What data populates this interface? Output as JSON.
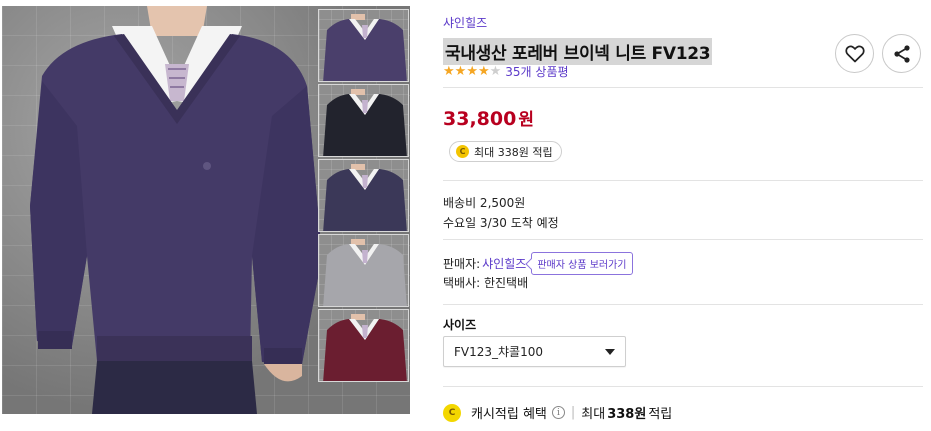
{
  "product": {
    "brand": "샤인힐즈",
    "title": "국내생산 포레버 브이넥 니트 FV123",
    "rating": 4,
    "rating_max": 5,
    "review_count_text": "35개 상품평",
    "price_value": "33,800",
    "price_unit": "원",
    "point_coin": "C",
    "point_text": "최대 338원 적립"
  },
  "delivery": {
    "fee_text": "배송비 2,500원",
    "arrival_text": "수요일 3/30 도착 예정"
  },
  "seller": {
    "label": "판매자:",
    "name": "샤인힐즈",
    "link_label": "판매자 상품 보러가기",
    "courier_text": "택배사: 한진택배"
  },
  "options": {
    "size_label": "사이즈",
    "size_selected": "FV123_챠콜100"
  },
  "cash": {
    "coin": "C",
    "label": "캐시적립 혜택",
    "info_glyph": "i",
    "separator": "|",
    "max_prefix": "최대",
    "max_amount": "338원",
    "max_suffix": "적립"
  },
  "icons": {
    "heart": "heart-icon",
    "share": "share-icon",
    "star": "star-icon",
    "dropdown": "chevron-down-icon"
  },
  "thumbnails": [
    {
      "color_name": "purple",
      "color": "#4a3f6b"
    },
    {
      "color_name": "black",
      "color": "#22232d"
    },
    {
      "color_name": "navy",
      "color": "#3b3858"
    },
    {
      "color_name": "gray",
      "color": "#a6a6ab"
    },
    {
      "color_name": "burgundy",
      "color": "#6b1e30"
    }
  ],
  "colors": {
    "accent": "#5b39c9",
    "price": "#b8001f",
    "star": "#f5a623",
    "coin": "#f3c400"
  }
}
